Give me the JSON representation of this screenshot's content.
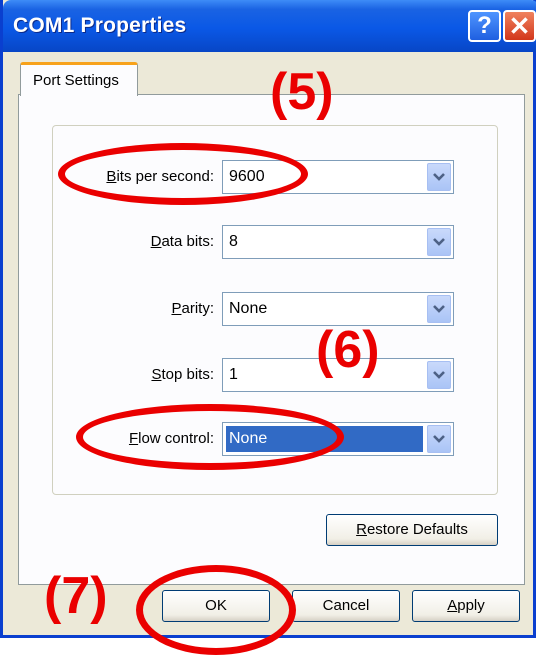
{
  "window": {
    "title": "COM1 Properties",
    "help_glyph": "?",
    "close_glyph": "✕"
  },
  "tabs": [
    {
      "label": "Port Settings",
      "active": true
    }
  ],
  "fields": [
    {
      "label_prefix": "",
      "label_mnemonic": "B",
      "label_rest": "its per second:",
      "value": "9600"
    },
    {
      "label_prefix": "",
      "label_mnemonic": "D",
      "label_rest": "ata bits:",
      "value": "8"
    },
    {
      "label_prefix": "",
      "label_mnemonic": "P",
      "label_rest": "arity:",
      "value": "None"
    },
    {
      "label_prefix": "",
      "label_mnemonic": "S",
      "label_rest": "top bits:",
      "value": "1"
    },
    {
      "label_prefix": "",
      "label_mnemonic": "F",
      "label_rest": "low control:",
      "value": "None"
    }
  ],
  "buttons": {
    "restore": {
      "mnemonic": "R",
      "rest": "estore Defaults"
    },
    "ok": "OK",
    "cancel": "Cancel",
    "apply": {
      "mnemonic": "A",
      "rest": "pply"
    }
  },
  "annotations": {
    "step5": "(5)",
    "step6": "(6)",
    "step7": "(7)",
    "color": "#ea0000"
  },
  "colors": {
    "titlebar": "#0a58e6",
    "selection": "#316ac5",
    "dialog_bg": "#ece9d8"
  }
}
